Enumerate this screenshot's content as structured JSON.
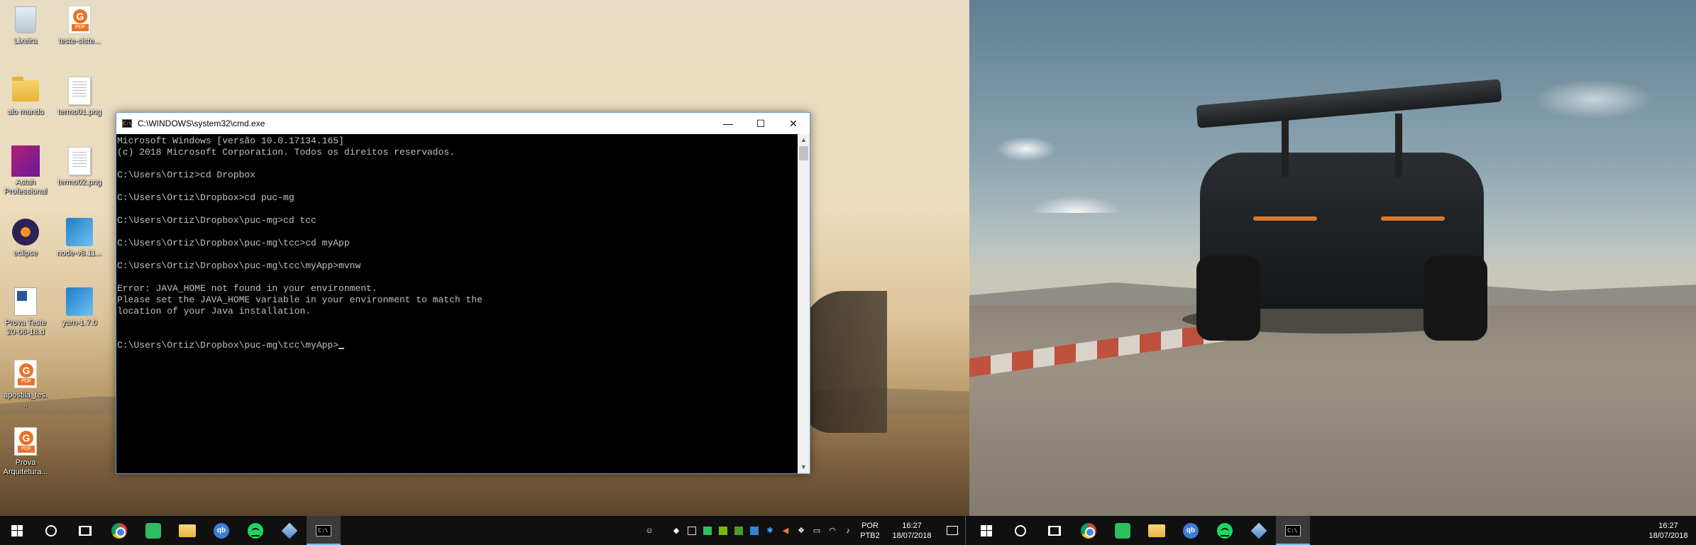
{
  "desktop_icons": [
    {
      "name": "recycle-bin",
      "label": "Lixeira",
      "icon": "recycle-bin-icon"
    },
    {
      "name": "pdf-file-1",
      "label": "teste-siste...",
      "icon": "pdf-icon"
    },
    {
      "name": "folder-alo-mundo",
      "label": "alo mundo",
      "icon": "folder-icon"
    },
    {
      "name": "image-file-1",
      "label": "termo01.png",
      "icon": "image-file-icon"
    },
    {
      "name": "astah-app",
      "label": "Astah Professional",
      "icon": "astah-icon"
    },
    {
      "name": "image-file-2",
      "label": "termo02.png",
      "icon": "image-file-icon"
    },
    {
      "name": "eclipse-app",
      "label": "eclipse",
      "icon": "eclipse-icon"
    },
    {
      "name": "node-installer",
      "label": "node-v8.11...",
      "icon": "installer-icon"
    },
    {
      "name": "word-doc",
      "label": "Prova Teste 20-06-18.d",
      "icon": "word-icon"
    },
    {
      "name": "yarn-installer",
      "label": "yarn-1.7.0",
      "icon": "installer-icon"
    },
    {
      "name": "pdf-file-2",
      "label": "apostila_tes...",
      "icon": "pdf-icon"
    },
    {
      "name": "pdf-file-3",
      "label": "Prova Arquitetura...",
      "icon": "pdf-icon"
    }
  ],
  "cmd_window": {
    "title": "C:\\WINDOWS\\system32\\cmd.exe",
    "icon_text": "C:\\",
    "minimize": "—",
    "maximize": "☐",
    "close": "✕",
    "lines": [
      "Microsoft Windows [versão 10.0.17134.165]",
      "(c) 2018 Microsoft Corporation. Todos os direitos reservados.",
      "",
      "C:\\Users\\Ortiz>cd Dropbox",
      "",
      "C:\\Users\\Ortiz\\Dropbox>cd puc-mg",
      "",
      "C:\\Users\\Ortiz\\Dropbox\\puc-mg>cd tcc",
      "",
      "C:\\Users\\Ortiz\\Dropbox\\puc-mg\\tcc>cd myApp",
      "",
      "C:\\Users\\Ortiz\\Dropbox\\puc-mg\\tcc\\myApp>mvnw",
      "",
      "Error: JAVA_HOME not found in your environment.",
      "Please set the JAVA_HOME variable in your environment to match the",
      "location of your Java installation.",
      "",
      ""
    ],
    "prompt": "C:\\Users\\Ortiz\\Dropbox\\puc-mg\\tcc\\myApp>"
  },
  "taskbar_left": {
    "apps": [
      "start",
      "cortana",
      "task-view",
      "chrome",
      "evernote",
      "file-explorer",
      "qbittorrent",
      "spotify",
      "virtualbox",
      "cmd"
    ],
    "qbit_text": "qb",
    "cmd_icon_text": "C:\\",
    "language_top": "POR",
    "language_bottom": "PTB2",
    "time": "16:27",
    "date": "18/07/2018"
  },
  "taskbar_right": {
    "qbit_text": "qb",
    "cmd_icon_text": "C:\\",
    "time": "16:27",
    "date": "18/07/2018"
  },
  "colors": {
    "taskbar": "#101010",
    "active_indicator": "#76b9ed",
    "console_text": "#c0c0c0"
  }
}
